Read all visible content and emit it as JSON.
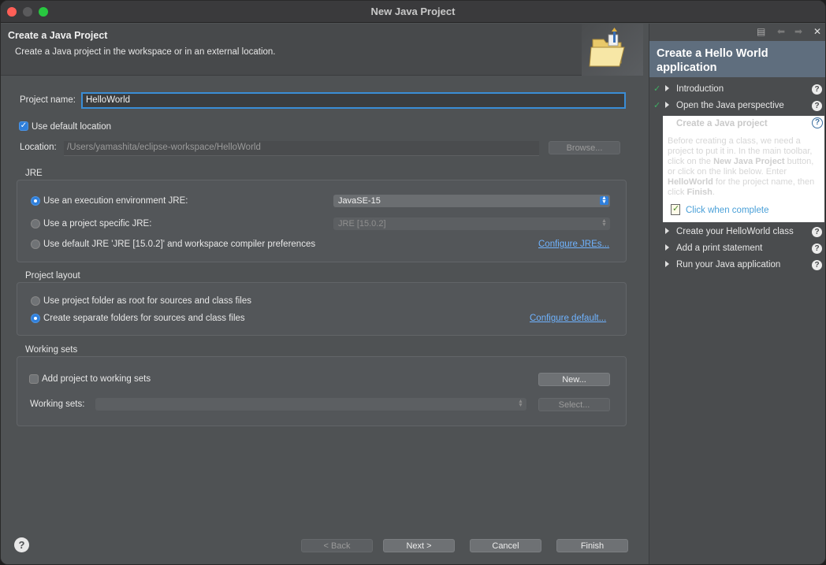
{
  "window": {
    "title": "New Java Project"
  },
  "wizard": {
    "title": "Create a Java Project",
    "description": "Create a Java project in the workspace or in an external location.",
    "project_name_label": "Project name:",
    "project_name_value": "HelloWorld",
    "use_default_location_label": "Use default location",
    "use_default_location_checked": true,
    "location_label": "Location:",
    "location_value": "/Users/yamashita/eclipse-workspace/HelloWorld",
    "browse_label": "Browse...",
    "jre": {
      "group_label": "JRE",
      "option_execution_env": "Use an execution environment JRE:",
      "execution_env_value": "JavaSE-15",
      "option_project_specific": "Use a project specific JRE:",
      "project_specific_value": "JRE [15.0.2]",
      "option_default": "Use default JRE 'JRE [15.0.2]' and workspace compiler preferences",
      "configure_link": "Configure JREs...",
      "selected": "execution_env"
    },
    "layout": {
      "group_label": "Project layout",
      "option_root": "Use project folder as root for sources and class files",
      "option_separate": "Create separate folders for sources and class files",
      "configure_link": "Configure default...",
      "selected": "separate"
    },
    "working_sets": {
      "group_label": "Working sets",
      "add_label": "Add project to working sets",
      "add_checked": false,
      "new_button": "New...",
      "sets_label": "Working sets:",
      "sets_value": "",
      "select_button": "Select..."
    },
    "footer": {
      "help": "?",
      "back": "< Back",
      "next": "Next >",
      "cancel": "Cancel",
      "finish": "Finish"
    }
  },
  "cheatsheet": {
    "title": "Create a Hello World application",
    "items": [
      {
        "label": "Introduction",
        "done": true
      },
      {
        "label": "Open the Java perspective",
        "done": true
      },
      {
        "label": "Create your HelloWorld class",
        "done": false
      },
      {
        "label": "Add a print statement",
        "done": false
      },
      {
        "label": "Run your Java application",
        "done": false
      }
    ],
    "current": {
      "title": "Create a Java project",
      "body_1": "Before creating a class, we need a project to put it in. In the main toolbar, click on the ",
      "body_bold_1": "New Java Project",
      "body_2": " button, or click on the link below. Enter ",
      "body_bold_2": "HelloWorld",
      "body_3": " for the project name, then click ",
      "body_bold_3": "Finish",
      "body_4": ".",
      "complete_label": "Click when complete"
    },
    "toolbar": {
      "collapse_icon": "collapse-icon",
      "back_icon": "arrow-left-icon",
      "forward_icon": "arrow-right-icon",
      "close_icon": "close-icon"
    }
  },
  "colors": {
    "accent": "#2f7fdb",
    "link": "#6fb3ff",
    "cheat_title_bg": "#5f6e7e"
  }
}
